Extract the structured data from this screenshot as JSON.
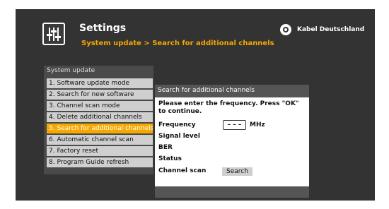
{
  "header": {
    "title": "Settings",
    "breadcrumb": "System update > Search for additional channels",
    "brand": "Kabel Deutschland"
  },
  "sidebar": {
    "title": "System update",
    "items": [
      {
        "label": "1. Software update mode"
      },
      {
        "label": "2. Search for new software"
      },
      {
        "label": "3. Channel scan mode"
      },
      {
        "label": "4. Delete additional channels"
      },
      {
        "label": "5. Search for additional channels",
        "active": true
      },
      {
        "label": "6. Automatic channel scan"
      },
      {
        "label": "7. Factory reset"
      },
      {
        "label": "8. Program Guide refresh"
      }
    ]
  },
  "dialog": {
    "title": "Search for additional channels",
    "instructions": "Please enter the frequency. Press \"OK\" to continue.",
    "fields": {
      "frequency_label": "Frequency",
      "frequency_value": "– – –",
      "frequency_unit": "MHz",
      "signal_level_label": "Signal level",
      "ber_label": "BER",
      "status_label": "Status",
      "channel_scan_label": "Channel scan"
    },
    "search_button": "Search"
  },
  "colors": {
    "accent": "#f5a800",
    "background": "#333333",
    "panel": "#4a4a4a",
    "menu_item": "#cfcfcf"
  },
  "icons": {
    "settings": "equalizer-sliders-icon",
    "brand": "kabel-deutschland-logo-icon"
  }
}
